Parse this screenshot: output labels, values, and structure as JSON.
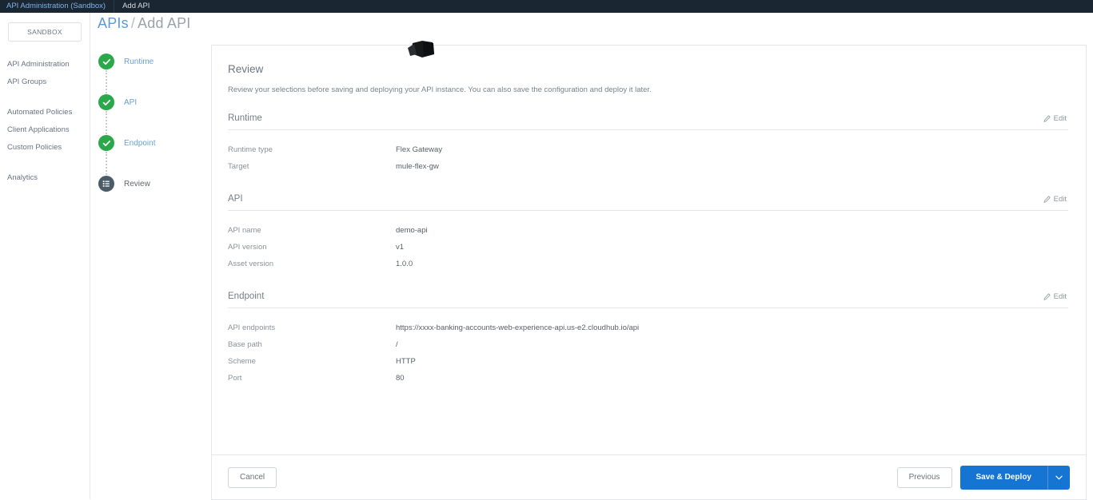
{
  "topbar": {
    "breadcrumb_link": "API Administration (Sandbox)",
    "current": "Add API"
  },
  "sidebar": {
    "environment": "SANDBOX",
    "groups": [
      {
        "items": [
          {
            "label": "API Administration"
          },
          {
            "label": "API Groups"
          }
        ]
      },
      {
        "items": [
          {
            "label": "Automated Policies"
          },
          {
            "label": "Client Applications"
          },
          {
            "label": "Custom Policies"
          }
        ]
      },
      {
        "items": [
          {
            "label": "Analytics"
          }
        ]
      }
    ]
  },
  "page": {
    "title_link": "APIs",
    "title_sep": "/",
    "title_current": "Add API"
  },
  "stepper": {
    "steps": [
      {
        "label": "Runtime",
        "state": "done",
        "icon": "check-icon"
      },
      {
        "label": "API",
        "state": "done",
        "icon": "check-icon"
      },
      {
        "label": "Endpoint",
        "state": "done",
        "icon": "check-icon"
      },
      {
        "label": "Review",
        "state": "current",
        "icon": "list-icon"
      }
    ]
  },
  "review": {
    "heading": "Review",
    "description": "Review your selections before saving and deploying your API instance. You can also save the configuration and deploy it later.",
    "edit_label": "Edit",
    "sections": [
      {
        "title": "Runtime",
        "rows": [
          {
            "label": "Runtime type",
            "value": "Flex Gateway"
          },
          {
            "label": "Target",
            "value": "mule-flex-gw"
          }
        ]
      },
      {
        "title": "API",
        "rows": [
          {
            "label": "API name",
            "value": "demo-api"
          },
          {
            "label": "API version",
            "value": "v1"
          },
          {
            "label": "Asset version",
            "value": "1.0.0"
          }
        ]
      },
      {
        "title": "Endpoint",
        "rows": [
          {
            "label": "API endpoints",
            "value": "https://xxxx-banking-accounts-web-experience-api.us-e2.cloudhub.io/api",
            "redacted": true
          },
          {
            "label": "Base path",
            "value": "/"
          },
          {
            "label": "Scheme",
            "value": "HTTP"
          },
          {
            "label": "Port",
            "value": "80"
          }
        ]
      }
    ]
  },
  "footer": {
    "cancel_label": "Cancel",
    "previous_label": "Previous",
    "save_deploy_label": "Save & Deploy",
    "caret_icon": "chevron-down-icon"
  },
  "colors": {
    "topbar_bg": "#1a2631",
    "primary_blue": "#1675d3",
    "link_blue": "#5b9bd5",
    "step_done_green": "#2ba84a",
    "step_current_slate": "#4b5c68",
    "border": "#e4e7ea"
  }
}
